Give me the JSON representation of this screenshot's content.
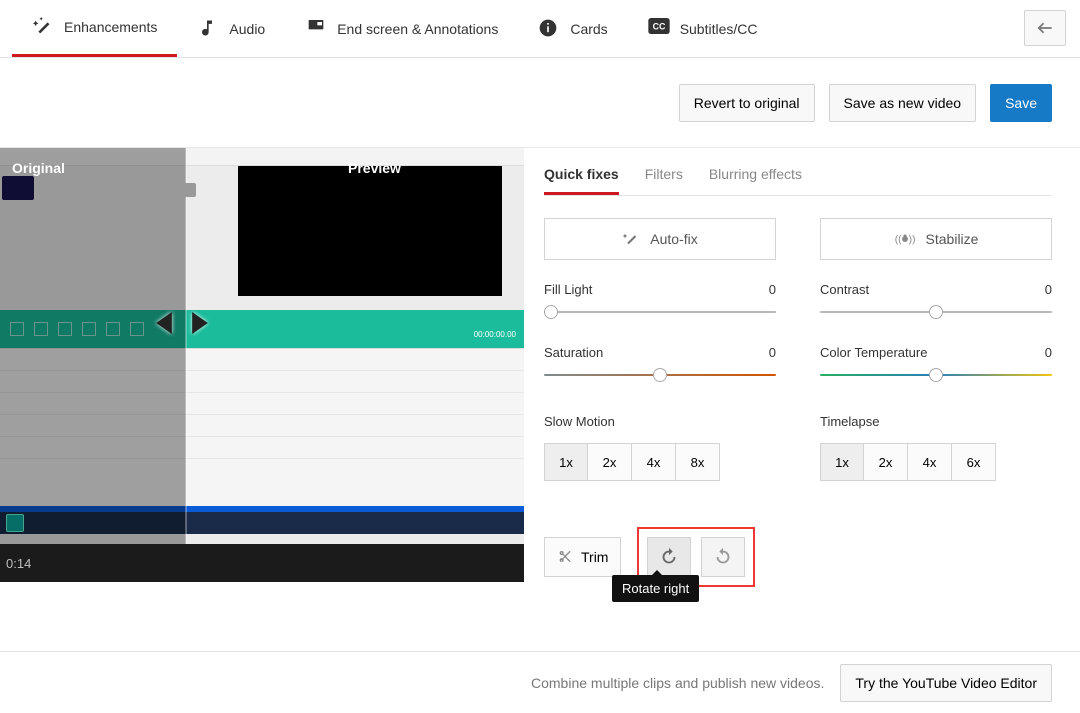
{
  "tabs": {
    "enhancements": "Enhancements",
    "audio": "Audio",
    "endscreen": "End screen & Annotations",
    "cards": "Cards",
    "subtitles": "Subtitles/CC"
  },
  "actions": {
    "revert": "Revert to original",
    "save_new": "Save as new video",
    "save": "Save"
  },
  "preview": {
    "original": "Original",
    "preview": "Preview",
    "time": "0:14",
    "fake_timecode": "00:00:00.00"
  },
  "subtabs": {
    "quick": "Quick fixes",
    "filters": "Filters",
    "blurring": "Blurring effects"
  },
  "quickfix": {
    "autofix": "Auto-fix",
    "stabilize": "Stabilize"
  },
  "sliders": {
    "fill_light": {
      "label": "Fill Light",
      "value": "0"
    },
    "contrast": {
      "label": "Contrast",
      "value": "0"
    },
    "saturation": {
      "label": "Saturation",
      "value": "0"
    },
    "color_temp": {
      "label": "Color Temperature",
      "value": "0"
    }
  },
  "speed": {
    "slow": {
      "label": "Slow Motion",
      "opts": [
        "1x",
        "2x",
        "4x",
        "8x"
      ],
      "selected": 0
    },
    "time": {
      "label": "Timelapse",
      "opts": [
        "1x",
        "2x",
        "4x",
        "6x"
      ],
      "selected": 0
    }
  },
  "trim": {
    "label": "Trim"
  },
  "rotate": {
    "tooltip": "Rotate right"
  },
  "footer": {
    "hint": "Combine multiple clips and publish new videos.",
    "btn": "Try the YouTube Video Editor"
  }
}
